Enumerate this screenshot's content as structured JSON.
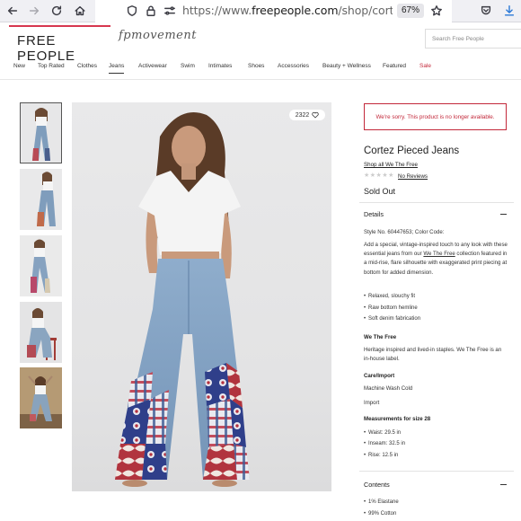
{
  "browser": {
    "url_prefix": "https://www.",
    "url_domain": "freepeople.com",
    "url_path": "/shop/cortez-pieced",
    "zoom": "67%"
  },
  "site": {
    "logo": "FREE PEOPLE",
    "sub_brand": "fpmovement",
    "search_placeholder": "Search Free People"
  },
  "nav": [
    "New",
    "Top Rated",
    "Clothes",
    "Jeans",
    "Activewear",
    "Swim",
    "Intimates",
    "Shoes",
    "Accessories",
    "Beauty + Wellness",
    "Featured",
    "Sale"
  ],
  "nav_active": "Jeans",
  "gallery": {
    "favorites_count": "2322"
  },
  "product": {
    "sorry_message": "We're sorry. This product is no longer available.",
    "title": "Cortez Pieced Jeans",
    "shop_all": "Shop all We The Free",
    "reviews": "No Reviews",
    "status": "Sold Out"
  },
  "details": {
    "heading": "Details",
    "style_no": "Style No. 60447653; Color Code:",
    "desc_pre": "Add a special, vintage-inspired touch to any look with these essential jeans from our ",
    "desc_link": "We The Free",
    "desc_post": " collection featured in a mid-rise, flare silhouette with exaggerated print piecing at bottom for added dimension.",
    "bullets": [
      "Relaxed, slouchy fit",
      "Raw bottom hemline",
      "Soft denim fabrication"
    ],
    "wtf_heading": "We The Free",
    "wtf_text": "Heritage inspired and lived-in staples. We The Free is an in-house label.",
    "care_heading": "Care/Import",
    "care_text": "Machine Wash Cold",
    "import_text": "Import",
    "measure_heading": "Measurements for size 28",
    "measurements": [
      "Waist: 29.5 in",
      "Inseam: 32.5 in",
      "Rise: 12.5 in"
    ]
  },
  "contents": {
    "heading": "Contents",
    "items": [
      "1% Elastane",
      "99% Cotton"
    ]
  }
}
